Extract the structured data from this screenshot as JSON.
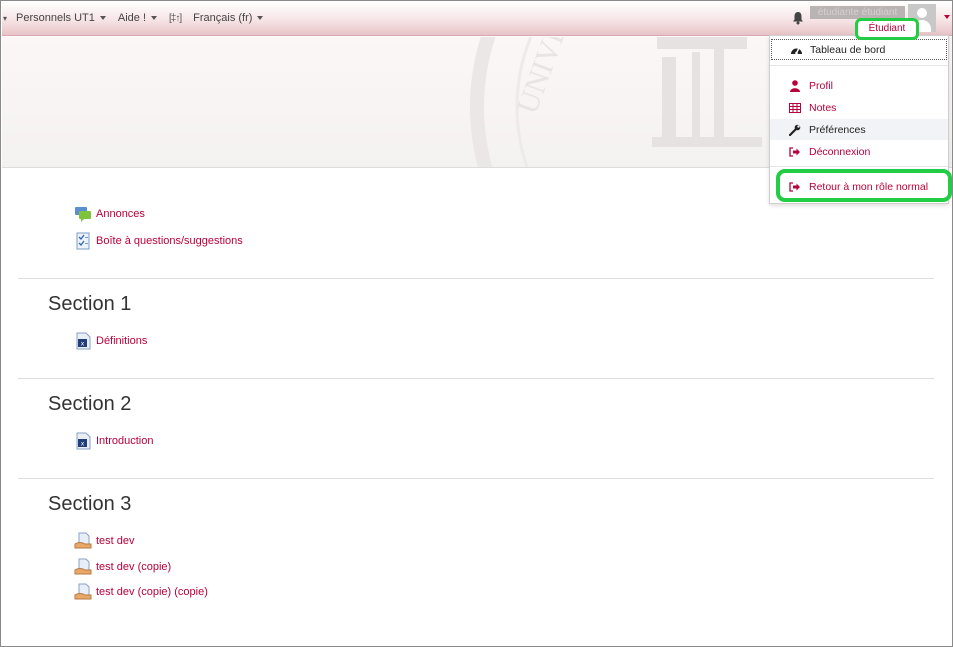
{
  "navbar": {
    "menu_items": [
      {
        "label": "Personnels UT1"
      },
      {
        "label": "Aide !"
      },
      {
        "label": "Français (fr)"
      }
    ],
    "edit_icon_glyph": "[‡↑]",
    "username": "étudiante étudiant",
    "role_badge": "Étudiant"
  },
  "user_menu": {
    "items": [
      {
        "label": "Tableau de bord",
        "icon": "dashboard-icon"
      },
      {
        "label": "Profil",
        "icon": "user-icon"
      },
      {
        "label": "Notes",
        "icon": "table-icon"
      },
      {
        "label": "Préférences",
        "icon": "wrench-icon"
      },
      {
        "label": "Déconnexion",
        "icon": "sign-out-icon"
      },
      {
        "label": "Retour à mon rôle normal",
        "icon": "sign-out-icon"
      }
    ]
  },
  "course": {
    "intro_activities": [
      {
        "label": "Annonces",
        "icon": "forum-icon"
      },
      {
        "label": "Boîte à questions/suggestions",
        "icon": "feedback-icon"
      }
    ],
    "sections": [
      {
        "title": "Section 1",
        "activities": [
          {
            "label": "Définitions",
            "icon": "excel-file-icon"
          }
        ]
      },
      {
        "title": "Section 2",
        "activities": [
          {
            "label": "Introduction",
            "icon": "excel-file-icon"
          }
        ]
      },
      {
        "title": "Section 3",
        "activities": [
          {
            "label": "test dev",
            "icon": "assignment-icon"
          },
          {
            "label": "test dev (copie)",
            "icon": "assignment-icon"
          },
          {
            "label": "test dev (copie) (copie)",
            "icon": "assignment-icon"
          }
        ]
      }
    ]
  },
  "colors": {
    "accent": "#b8003a",
    "highlight": "#22cc44",
    "navbar_bottom": "#e8c3c7"
  }
}
